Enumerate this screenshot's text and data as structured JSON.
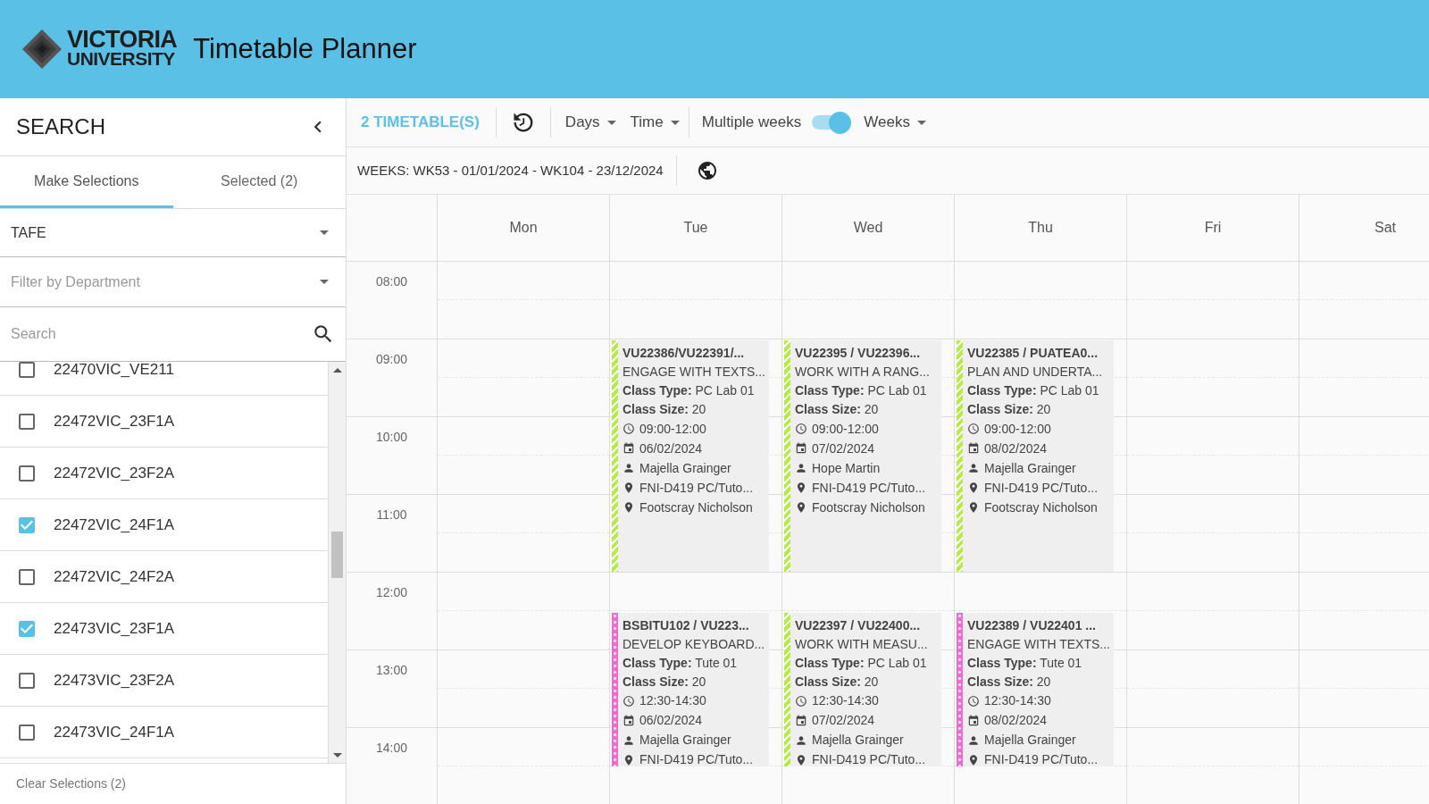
{
  "header": {
    "brand_line_1": "VICTORIA",
    "brand_line_2": "UNIVERSITY",
    "title": "Timetable Planner"
  },
  "search_panel": {
    "title": "SEARCH",
    "tabs": [
      {
        "label": "Make Selections",
        "selected": true
      },
      {
        "label": "Selected (2)",
        "selected": false
      }
    ],
    "category": {
      "value": "TAFE"
    },
    "department": {
      "placeholder": "Filter by Department"
    },
    "search": {
      "placeholder": "Search"
    },
    "items": [
      {
        "label": "22470VIC_VE211",
        "checked": false
      },
      {
        "label": "22472VIC_23F1A",
        "checked": false
      },
      {
        "label": "22472VIC_23F2A",
        "checked": false
      },
      {
        "label": "22472VIC_24F1A",
        "checked": true
      },
      {
        "label": "22472VIC_24F2A",
        "checked": false
      },
      {
        "label": "22473VIC_23F1A",
        "checked": true
      },
      {
        "label": "22473VIC_23F2A",
        "checked": false
      },
      {
        "label": "22473VIC_24F1A",
        "checked": false
      }
    ],
    "clear_button": "Clear Selections (2)"
  },
  "toolbar": {
    "timetables": "2 TIMETABLE(S)",
    "days": "Days",
    "time": "Time",
    "multiple_weeks": {
      "label": "Multiple weeks",
      "on": true
    },
    "weeks": "Weeks",
    "weeks_range": "WEEKS: WK53 - 01/01/2024 - WK104 - 23/12/2024"
  },
  "timetable": {
    "times": [
      "08:00",
      "09:00",
      "10:00",
      "11:00",
      "12:00",
      "13:00",
      "14:00"
    ],
    "days": [
      {
        "label": "Mon"
      },
      {
        "label": "Tue",
        "events": [
          {
            "code": "VU22386/VU22391/...",
            "title": "ENGAGE WITH TEXTS...",
            "class_type_label": "Class Type:",
            "class_type": "PC Lab 01",
            "class_size_label": "Class Size:",
            "class_size": "20",
            "time": "09:00-12:00",
            "date": "06/02/2024",
            "staff": "Majella Grainger",
            "room": "FNI-D419 PC/Tuto...",
            "campus": "Footscray Nicholson",
            "color": "#b5ec4c",
            "kind": "striped"
          },
          {
            "code": "BSBITU102 / VU223...",
            "title": "DEVELOP KEYBOARD...",
            "class_type_label": "Class Type:",
            "class_type": "Tute 01",
            "class_size_label": "Class Size:",
            "class_size": "20",
            "time": "12:30-14:30",
            "date": "06/02/2024",
            "staff": "Majella Grainger",
            "room": "FNI-D419 PC/Tuto...",
            "color": "#f06bd1",
            "kind": "dotted"
          }
        ]
      },
      {
        "label": "Wed",
        "events": [
          {
            "code": "VU22395 / VU22396...",
            "title": "WORK WITH A RANG...",
            "class_type_label": "Class Type:",
            "class_type": "PC Lab 01",
            "class_size_label": "Class Size:",
            "class_size": "20",
            "time": "09:00-12:00",
            "date": "07/02/2024",
            "staff": "Hope Martin",
            "room": "FNI-D419 PC/Tuto...",
            "campus": "Footscray Nicholson",
            "color": "#b5ec4c",
            "kind": "striped"
          },
          {
            "code": "VU22397 / VU22400...",
            "title": "WORK WITH MEASU...",
            "class_type_label": "Class Type:",
            "class_type": "PC Lab 01",
            "class_size_label": "Class Size:",
            "class_size": "20",
            "time": "12:30-14:30",
            "date": "07/02/2024",
            "staff": "Majella Grainger",
            "room": "FNI-D419 PC/Tuto...",
            "color": "#b5ec4c",
            "kind": "striped"
          }
        ]
      },
      {
        "label": "Thu",
        "events": [
          {
            "code": "VU22385 / PUATEA0...",
            "title": "PLAN AND UNDERTA...",
            "class_type_label": "Class Type:",
            "class_type": "PC Lab 01",
            "class_size_label": "Class Size:",
            "class_size": "20",
            "time": "09:00-12:00",
            "date": "08/02/2024",
            "staff": "Majella Grainger",
            "room": "FNI-D419 PC/Tuto...",
            "campus": "Footscray Nicholson",
            "color": "#b5ec4c",
            "kind": "striped"
          },
          {
            "code": "VU22389 / VU22401 ...",
            "title": "ENGAGE WITH TEXTS...",
            "class_type_label": "Class Type:",
            "class_type": "Tute 01",
            "class_size_label": "Class Size:",
            "class_size": "20",
            "time": "12:30-14:30",
            "date": "08/02/2024",
            "staff": "Majella Grainger",
            "room": "FNI-D419 PC/Tuto...",
            "color": "#f06bd1",
            "kind": "dotted"
          }
        ]
      },
      {
        "label": "Fri"
      },
      {
        "label": "Sat"
      }
    ]
  }
}
